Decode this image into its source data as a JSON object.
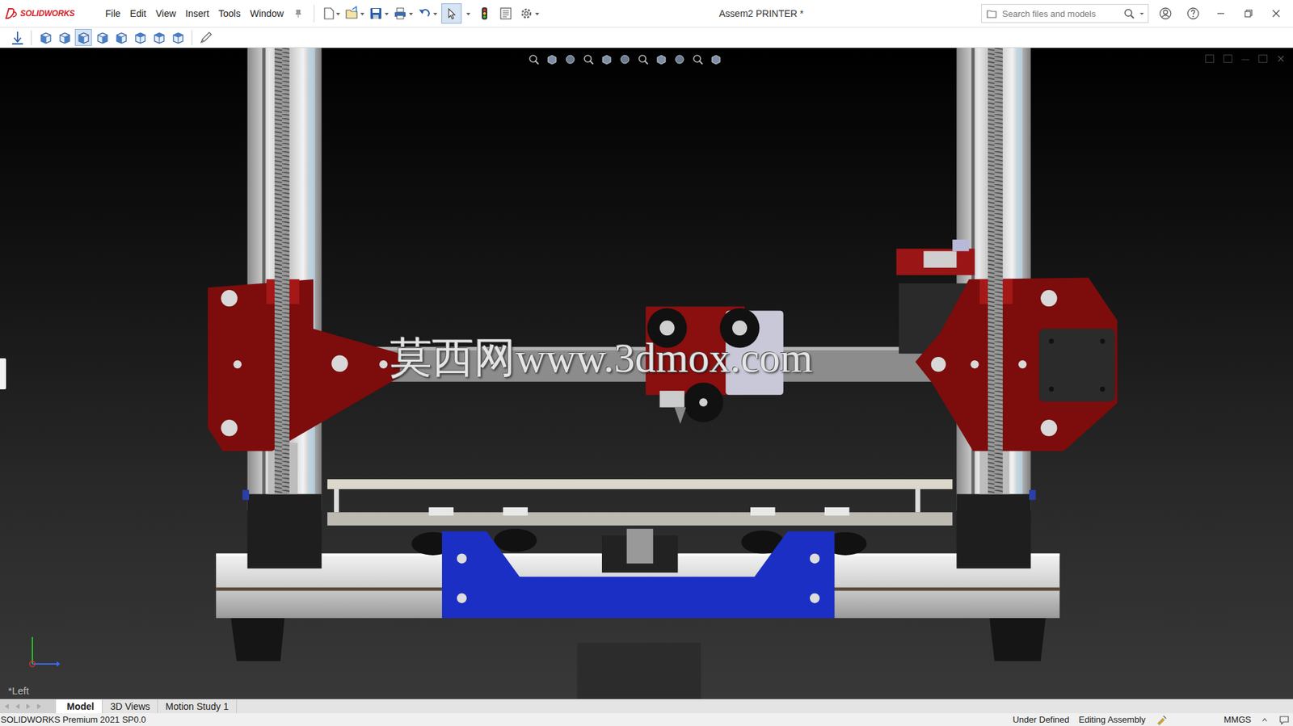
{
  "app": {
    "logo": "SOLIDWORKS",
    "title": "Assem2 PRINTER *"
  },
  "menu": [
    "File",
    "Edit",
    "View",
    "Insert",
    "Tools",
    "Window"
  ],
  "select_tool": {
    "pressed": true
  },
  "view_buttons": [
    {
      "pressed": false
    },
    {
      "pressed": false
    },
    {
      "pressed": true
    },
    {
      "pressed": false
    },
    {
      "pressed": false
    },
    {
      "pressed": false
    },
    {
      "pressed": false
    },
    {
      "pressed": false
    }
  ],
  "search": {
    "placeholder": "Search files and models"
  },
  "viewport": {
    "view_label": "*Left",
    "watermark": "莫西网www.3dmox.com"
  },
  "tabs": [
    {
      "label": "Model",
      "selected": true
    },
    {
      "label": "3D Views",
      "selected": false
    },
    {
      "label": "Motion Study 1",
      "selected": false
    }
  ],
  "status_bar": {
    "product": "SOLIDWORKS Premium 2021 SP0.0",
    "items": [
      "Under Defined",
      "Editing Assembly",
      "MMGS"
    ]
  }
}
